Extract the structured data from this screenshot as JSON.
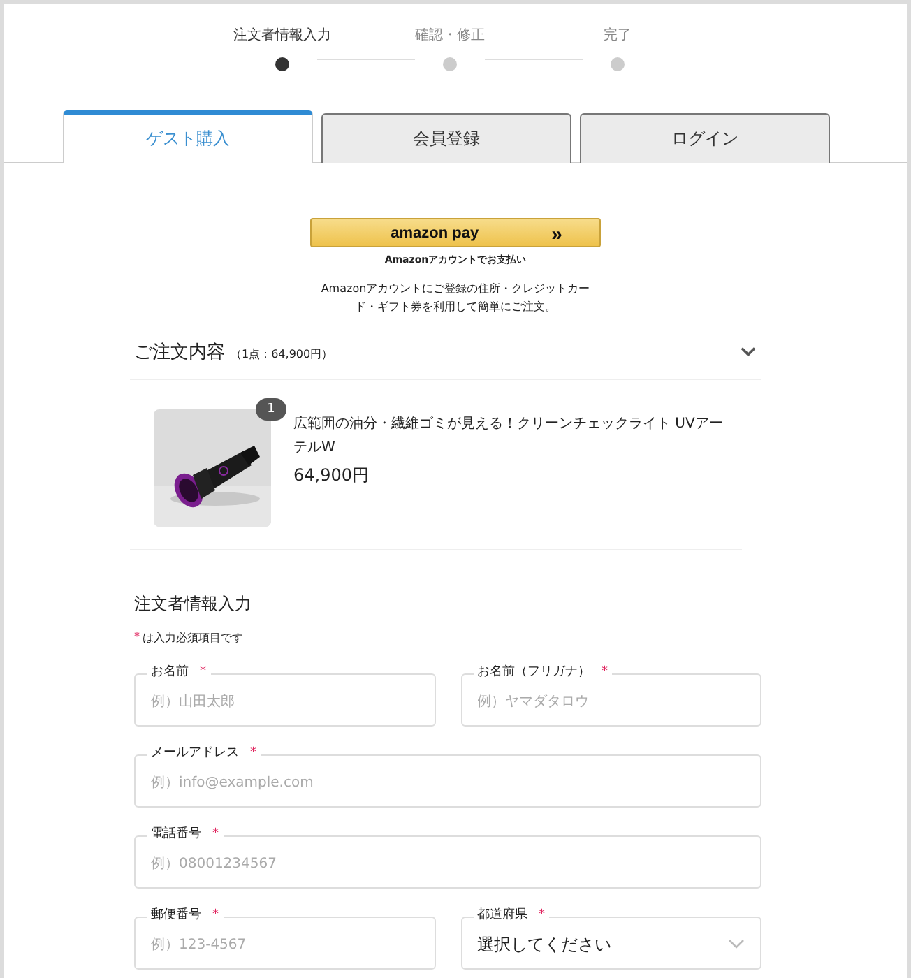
{
  "steps": [
    {
      "label": "注文者情報入力",
      "selected": true
    },
    {
      "label": "確認・修正",
      "selected": false
    },
    {
      "label": "完了",
      "selected": false
    }
  ],
  "tabs": [
    {
      "label": "ゲスト購入",
      "selected": true
    },
    {
      "label": "会員登録",
      "selected": false
    },
    {
      "label": "ログイン",
      "selected": false
    }
  ],
  "amazon_pay": {
    "logo": "amazon pay",
    "arrow": "»",
    "caption": "Amazonアカウントでお支払い",
    "description": "Amazonアカウントにご登録の住所・クレジットカード・ギフト券を利用して簡単にご注文。"
  },
  "order_summary": {
    "title": "ご注文内容",
    "summary": "（1点：64,900円）",
    "expanded": true,
    "items": [
      {
        "quantity": "1",
        "name": "広範囲の油分・繊維ゴミが見える！クリーンチェックライト UVアーテルW",
        "price": "64,900円",
        "kind": "picture"
      }
    ]
  },
  "form": {
    "title": "注文者情報入力",
    "legend_mark": "*",
    "legend": "は入力必須項目です",
    "rows": [
      [
        {
          "kind": "input",
          "label": "お名前",
          "required_mark": "*",
          "placeholder": "例）山田太郎"
        },
        {
          "kind": "input",
          "label": "お名前（フリガナ）",
          "required_mark": "*",
          "placeholder": "例）ヤマダタロウ"
        }
      ],
      [
        {
          "kind": "input",
          "label": "メールアドレス",
          "required_mark": "*",
          "placeholder": "例）info@example.com"
        }
      ],
      [
        {
          "kind": "input",
          "label": "電話番号",
          "required_mark": "*",
          "placeholder": "例）08001234567"
        }
      ],
      [
        {
          "kind": "input",
          "label": "郵便番号",
          "required_mark": "*",
          "placeholder": "例）123-4567"
        },
        {
          "kind": "select",
          "label": "都道府県",
          "required_mark": "*",
          "value": "選択してください"
        }
      ]
    ]
  }
}
